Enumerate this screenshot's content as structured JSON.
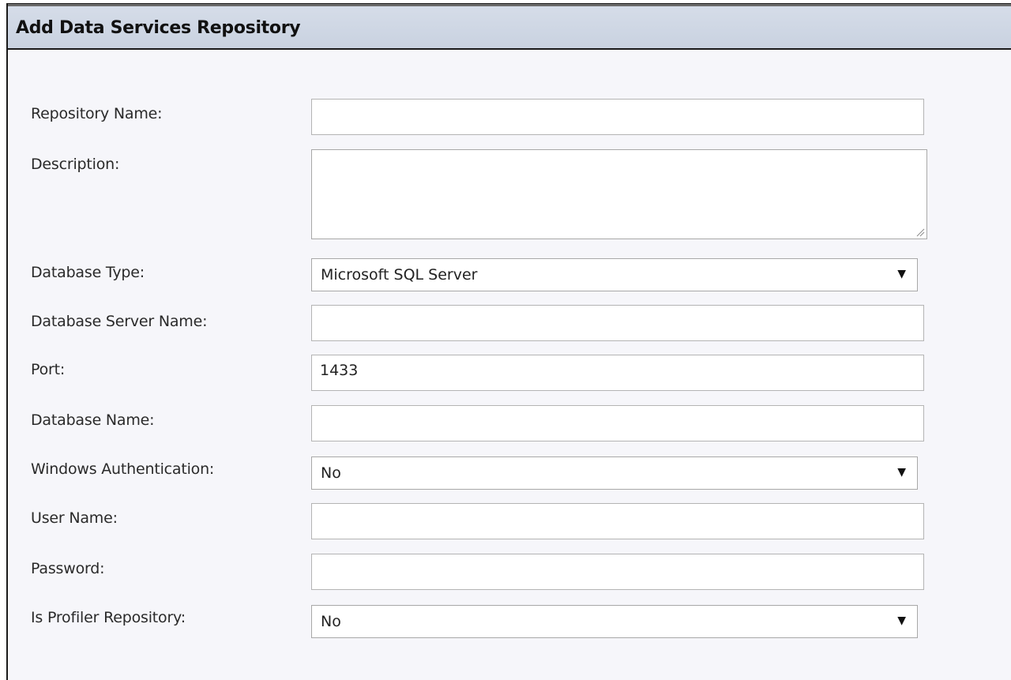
{
  "dialog": {
    "title": "Add Data Services Repository"
  },
  "form": {
    "repository_name": {
      "label": "Repository Name:",
      "value": ""
    },
    "description": {
      "label": "Description:",
      "value": ""
    },
    "database_type": {
      "label": "Database Type:",
      "value": "Microsoft SQL Server"
    },
    "database_server_name": {
      "label": "Database Server Name:",
      "value": ""
    },
    "port": {
      "label": "Port:",
      "value": "1433"
    },
    "database_name": {
      "label": "Database Name:",
      "value": ""
    },
    "windows_authentication": {
      "label": "Windows Authentication:",
      "value": "No"
    },
    "user_name": {
      "label": "User Name:",
      "value": ""
    },
    "password": {
      "label": "Password:",
      "value": ""
    },
    "is_profiler_repository": {
      "label": "Is Profiler Repository:",
      "value": "No"
    }
  },
  "icons": {
    "dropdown_arrow": "▼"
  }
}
